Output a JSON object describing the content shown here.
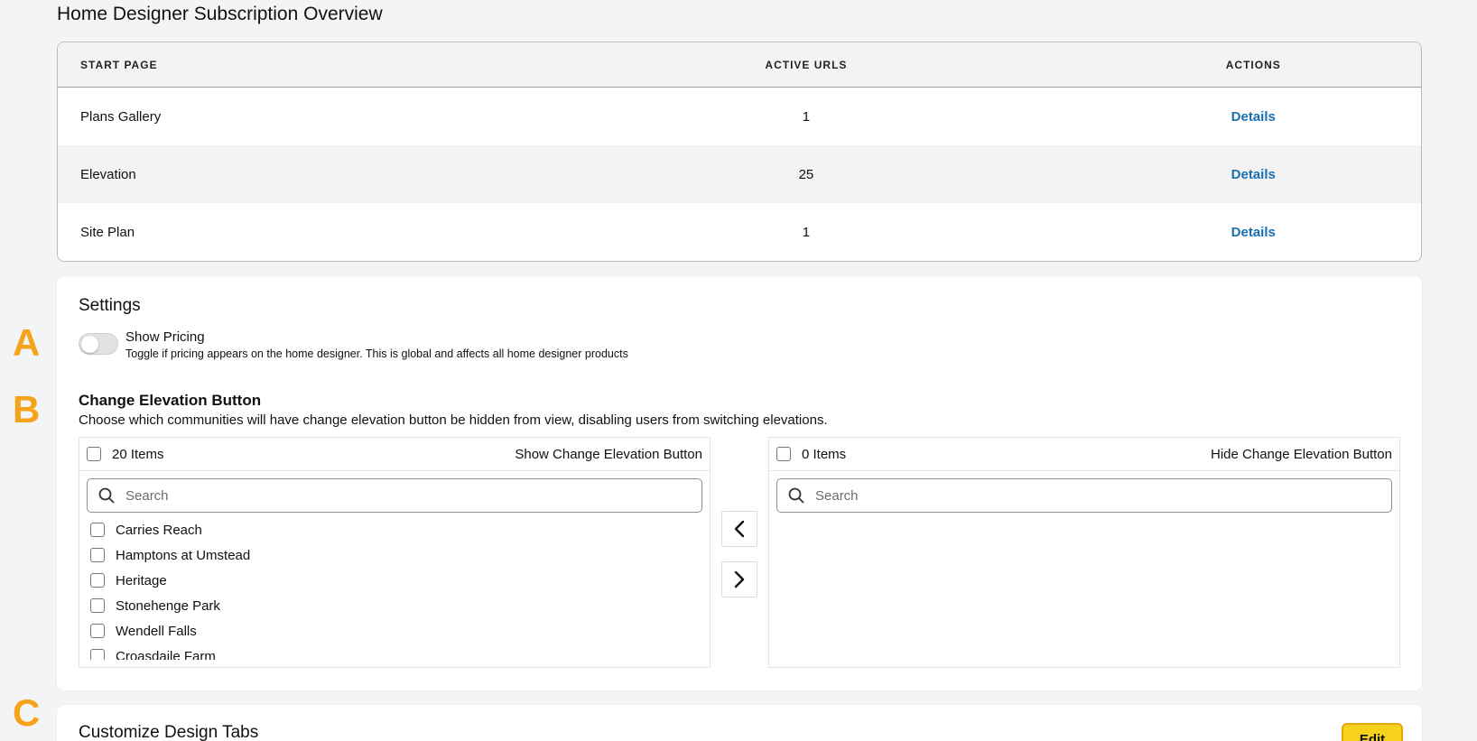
{
  "page_title": "Home Designer Subscription Overview",
  "table": {
    "headers": [
      "START PAGE",
      "ACTIVE URLS",
      "ACTIONS"
    ],
    "rows": [
      {
        "start_page": "Plans Gallery",
        "active_urls": "1",
        "action": "Details"
      },
      {
        "start_page": "Elevation",
        "active_urls": "25",
        "action": "Details"
      },
      {
        "start_page": "Site Plan",
        "active_urls": "1",
        "action": "Details"
      }
    ]
  },
  "annotations": {
    "a": "A",
    "b": "B",
    "c": "C"
  },
  "settings": {
    "title": "Settings",
    "show_pricing": {
      "label": "Show Pricing",
      "description": "Toggle if pricing appears on the home designer. This is global and affects all home designer products",
      "enabled": false
    },
    "change_elevation": {
      "title": "Change Elevation Button",
      "description": "Choose which communities will have change elevation button be hidden from view, disabling users from switching elevations.",
      "left_panel": {
        "count": "20 Items",
        "heading": "Show Change Elevation Button",
        "search_placeholder": "Search",
        "items": [
          "Carries Reach",
          "Hamptons at Umstead",
          "Heritage",
          "Stonehenge Park",
          "Wendell Falls",
          "Croasdaile Farm"
        ]
      },
      "right_panel": {
        "count": "0 Items",
        "heading": "Hide Change Elevation Button",
        "search_placeholder": "Search"
      }
    }
  },
  "customize_tabs": {
    "title": "Customize Design Tabs",
    "edit_label": "Edit"
  },
  "colors": {
    "link": "#1a6fb0",
    "annotation": "#f7a21b",
    "edit_button": "#f7d21c"
  },
  "icons": [
    "search-icon",
    "chevron-left-icon",
    "chevron-right-icon"
  ]
}
